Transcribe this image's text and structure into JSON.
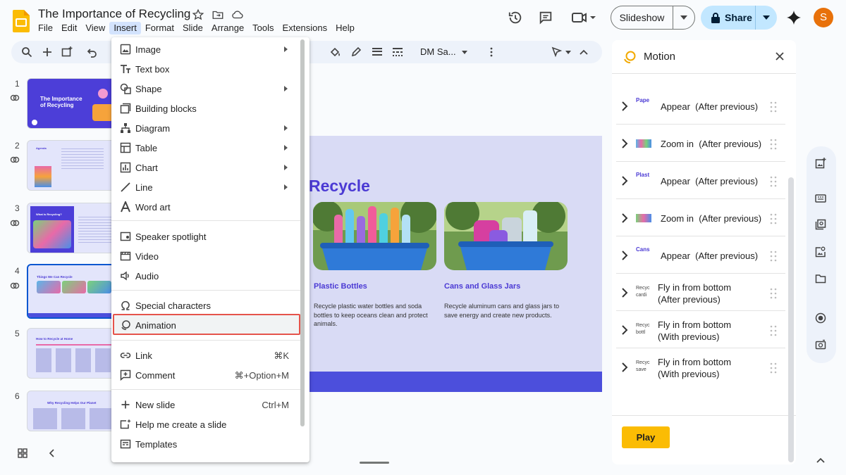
{
  "title_bar": {
    "doc_title": "The Importance of Recycling",
    "menus": [
      "File",
      "Edit",
      "View",
      "Insert",
      "Format",
      "Slide",
      "Arrange",
      "Tools",
      "Extensions",
      "Help"
    ],
    "active_menu": "Insert",
    "slideshow_label": "Slideshow",
    "share_label": "Share",
    "avatar_initial": "S"
  },
  "toolbar": {
    "font_name": "DM Sa..."
  },
  "filmstrip": {
    "slides": [
      {
        "number": "1",
        "title": "The Importance of Recycling"
      },
      {
        "number": "2",
        "title": "Agenda"
      },
      {
        "number": "3",
        "title": "What is Recycling?"
      },
      {
        "number": "4",
        "title": "Things We Can Recycle"
      },
      {
        "number": "5",
        "title": "How to Recycle at Home"
      },
      {
        "number": "6",
        "title": "Why Recycling Helps Our Planet"
      }
    ],
    "selected": "4"
  },
  "slide": {
    "title_visible": "Recycle",
    "cards": [
      {
        "title": "Plastic Bottles",
        "body": "Recycle plastic water bottles and soda bottles to keep oceans clean and protect animals."
      },
      {
        "title": "Cans and Glass Jars",
        "body": "Recycle aluminum cans and glass jars to save energy and create new products."
      }
    ]
  },
  "insert_menu": {
    "groups": [
      [
        {
          "label": "Image",
          "icon": "image-icon",
          "submenu": true
        },
        {
          "label": "Text box",
          "icon": "text-box-icon"
        },
        {
          "label": "Shape",
          "icon": "shape-icon",
          "submenu": true
        },
        {
          "label": "Building blocks",
          "icon": "building-blocks-icon"
        },
        {
          "label": "Diagram",
          "icon": "diagram-icon",
          "submenu": true
        },
        {
          "label": "Table",
          "icon": "table-icon",
          "submenu": true
        },
        {
          "label": "Chart",
          "icon": "chart-icon",
          "submenu": true
        },
        {
          "label": "Line",
          "icon": "line-icon",
          "submenu": true
        },
        {
          "label": "Word art",
          "icon": "word-art-icon"
        }
      ],
      [
        {
          "label": "Speaker spotlight",
          "icon": "speaker-spotlight-icon"
        },
        {
          "label": "Video",
          "icon": "video-icon"
        },
        {
          "label": "Audio",
          "icon": "audio-icon"
        }
      ],
      [
        {
          "label": "Special characters",
          "icon": "omega-icon"
        },
        {
          "label": "Animation",
          "icon": "animation-icon",
          "highlighted": true
        }
      ],
      [
        {
          "label": "Link",
          "icon": "link-icon",
          "shortcut": "⌘K"
        },
        {
          "label": "Comment",
          "icon": "comment-icon",
          "shortcut": "⌘+Option+M"
        }
      ],
      [
        {
          "label": "New slide",
          "icon": "plus-icon",
          "shortcut": "Ctrl+M"
        },
        {
          "label": "Help me create a slide",
          "icon": "ai-slide-icon"
        },
        {
          "label": "Templates",
          "icon": "templates-icon"
        }
      ]
    ]
  },
  "motion_panel": {
    "title": "Motion",
    "animations": [
      {
        "preview": "Pape",
        "effect": "Appear",
        "timing": "(After previous)"
      },
      {
        "preview": "",
        "effect": "Zoom in",
        "timing": "(After previous)"
      },
      {
        "preview": "Plast",
        "effect": "Appear",
        "timing": "(After previous)"
      },
      {
        "preview": "",
        "effect": "Zoom in",
        "timing": "(After previous)"
      },
      {
        "preview": "Cans",
        "effect": "Appear",
        "timing": "(After previous)"
      },
      {
        "preview": "Recyc cardi",
        "effect": "Fly in from bottom",
        "timing": "(After previous)"
      },
      {
        "preview": "Recyc bottl",
        "effect": "Fly in from bottom",
        "timing": "(With previous)"
      },
      {
        "preview": "Recyc save",
        "effect": "Fly in from bottom",
        "timing": "(With previous)"
      }
    ],
    "play_label": "Play"
  },
  "colors": {
    "accent": "#4b3ad4",
    "highlight_border": "#e5534b",
    "play_button": "#fbbc04",
    "share_button": "#c2e7ff"
  }
}
